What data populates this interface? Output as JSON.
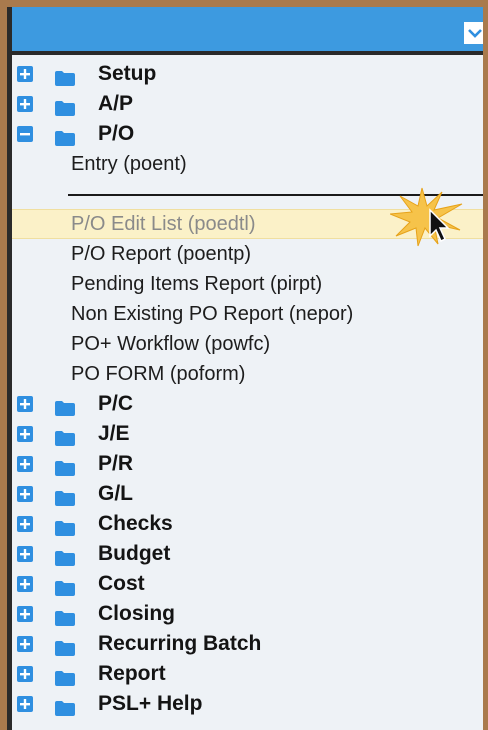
{
  "tree": {
    "top_folders": [
      {
        "label": "Setup",
        "expanded": false
      },
      {
        "label": "A/P",
        "expanded": false
      },
      {
        "label": "P/O",
        "expanded": true
      }
    ],
    "po_children": [
      "Entry (poent)",
      "P/O Edit List (poedtl)",
      "P/O Report (poentp)",
      "Pending Items Report (pirpt)",
      "Non Existing PO Report (nepor)",
      "PO+ Workflow (powfc)",
      "PO FORM (poform)"
    ],
    "bottom_folders": [
      {
        "label": "P/C"
      },
      {
        "label": "J/E"
      },
      {
        "label": "P/R"
      },
      {
        "label": "G/L"
      },
      {
        "label": "Checks"
      },
      {
        "label": "Budget"
      },
      {
        "label": "Cost"
      },
      {
        "label": "Closing"
      },
      {
        "label": "Recurring Batch"
      },
      {
        "label": "Report"
      },
      {
        "label": "PSL+ Help"
      }
    ]
  },
  "icons": {
    "expand": "plus-square-icon",
    "collapse": "minus-square-icon",
    "folder": "folder-icon",
    "dropdown": "chevron-down-icon",
    "cursor": "mouse-pointer-icon"
  },
  "colors": {
    "titlebar": "#3d9ae0",
    "toggle": "#2f8fe0",
    "folder": "#2f8fe0",
    "highlight": "#fbf1c8",
    "frame": "#a97a4d"
  }
}
